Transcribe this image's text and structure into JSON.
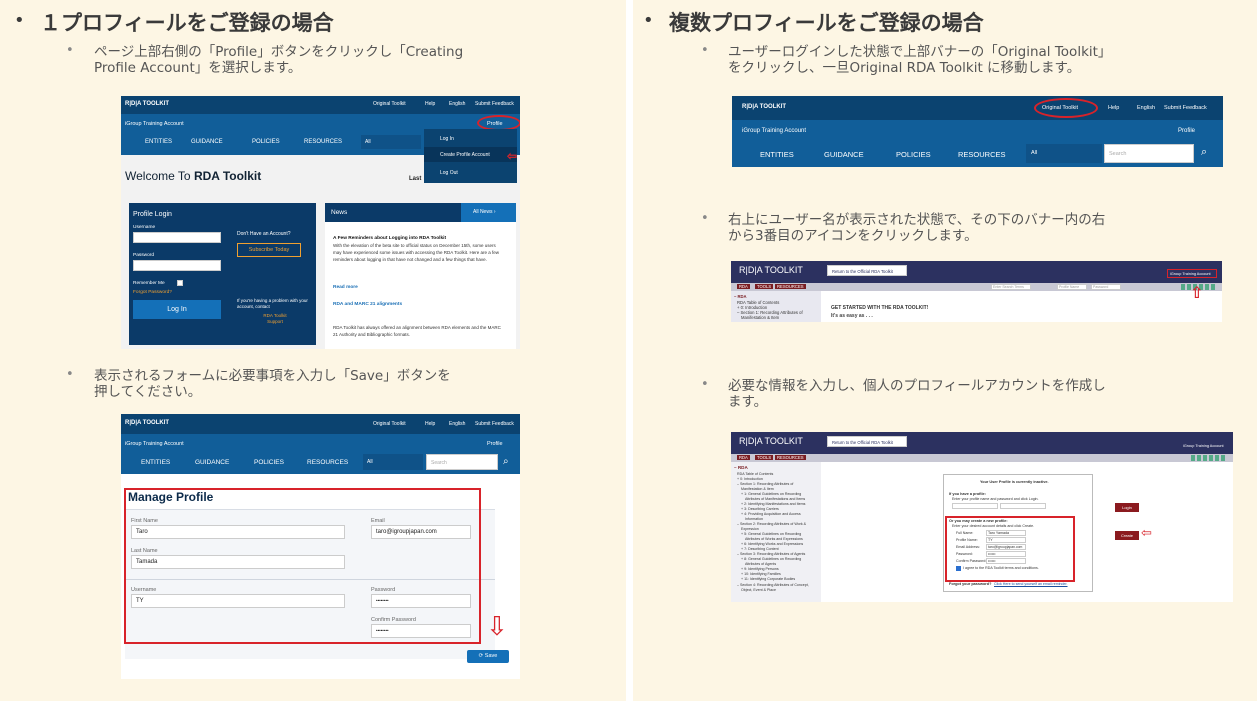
{
  "left": {
    "heading": "１プロフィールをご登録の場合",
    "step1": [
      "ページ上部右側の「Profile」ボタンをクリックし「Creating",
      "Profile Account」を選択します。"
    ],
    "step2": [
      "表示されるフォームに必要事項を入力し「Save」ボタンを",
      "押してください。"
    ],
    "shot1": {
      "logo": "R|D|A TOOLKIT",
      "top_links": [
        "Original Toolkit",
        "Help",
        "English",
        "Submit Feedback"
      ],
      "account": "iGroup Training Account",
      "profile": "Profile",
      "nav": [
        "ENTITIES",
        "GUIDANCE",
        "POLICIES",
        "RESOURCES",
        "All"
      ],
      "menu": [
        "Log In",
        "Create Profile Account",
        "Log Out"
      ],
      "welcome": "Welcome To",
      "welcome_bold": "RDA Toolkit",
      "last": "Last",
      "login": {
        "title": "Profile Login",
        "username": "Username",
        "password": "Password",
        "remember": "Remember Me",
        "forgot": "Forgot Password?",
        "button": "Log In",
        "no_account": "Don't Have an Account?",
        "subscribe": "Subscribe Today",
        "problem": "If you're having a problem with your account, contact",
        "support": "RDA Toolkit Support"
      },
      "news": {
        "title": "News",
        "all": "All News ›",
        "h1": "A Few Reminders about Logging into RDA Toolkit",
        "p1": "With the elevation of the beta site to official status on December 15th, some users may have experienced some issues with accessing the RDA Toolkit. Here are a few reminders about logging in that have not changed and a few things that have.",
        "more": "Read more",
        "h2": "RDA and MARC 21 alignments",
        "p2": "RDA Toolkit has always offered an alignment between RDA elements and the MARC 21 Authority and Bibliographic formats."
      }
    },
    "shot2": {
      "logo": "R|D|A TOOLKIT",
      "top_links": [
        "Original Toolkit",
        "Help",
        "English",
        "Submit Feedback"
      ],
      "account": "iGroup Training Account",
      "profile": "Profile",
      "nav": [
        "ENTITIES",
        "GUIDANCE",
        "POLICIES",
        "RESOURCES",
        "All"
      ],
      "search": "Search",
      "title": "Manage Profile",
      "first_name_label": "First Name",
      "first_name": "Taro",
      "email_label": "Email",
      "email": "taro@igroupjapan.com",
      "last_name_label": "Last Name",
      "last_name": "Tamada",
      "username_label": "Username",
      "username": "TY",
      "password_label": "Password",
      "password": "••••••••",
      "confirm_label": "Confirm Password",
      "confirm": "••••••••",
      "save": "Save"
    }
  },
  "right": {
    "heading": "複数プロフィールをご登録の場合",
    "step1": [
      "ユーザーログインした状態で上部バナーの「Original Toolkit」",
      "をクリックし、一旦Original RDA Toolkit に移動します。"
    ],
    "step2": [
      "右上にユーザー名が表示された状態で、その下のバナー内の右",
      "から3番目のアイコンをクリックします。"
    ],
    "step3": [
      "必要な情報を入力し、個人のプロフィールアカウントを作成し",
      "ます。"
    ],
    "shot1": {
      "logo": "R|D|A TOOLKIT",
      "top_links": [
        "Original Toolkit",
        "Help",
        "English",
        "Submit Feedback"
      ],
      "account": "iGroup Training Account",
      "profile": "Profile",
      "nav": [
        "ENTITIES",
        "GUIDANCE",
        "POLICIES",
        "RESOURCES",
        "All"
      ],
      "search": "Search"
    },
    "shot2": {
      "logo": "R|D|A TOOLKIT",
      "return": "Return to the Official RDA Toolkit",
      "account": "iGroup Training Account",
      "tabs": [
        "RDA",
        "TOOLS",
        "RESOURCES"
      ],
      "search_ph": "Enter Search Terms",
      "profile_ph": "Profile Name",
      "pw_ph": "Password",
      "get_started": "GET STARTED WITH THE RDA TOOLKIT!",
      "easy": "It's as easy as . . .",
      "toc": [
        "– RDA",
        "RDA Table of Contents",
        "+ 0: Introduction",
        "– Section 1: Recording Attributes of",
        "Manifestation & Item"
      ]
    },
    "shot3": {
      "logo": "R|D|A TOOLKIT",
      "return": "Return to the Official RDA Toolkit",
      "account": "iGroup Training Account",
      "tabs": [
        "RDA",
        "TOOLS",
        "RESOURCES"
      ],
      "inactive": "Your User Profile is currently inactive.",
      "have": "If you have a profile:",
      "have_hint": "Enter your profile name and password and click Login.",
      "login": "Login",
      "create_title": "Or you may create a new profile:",
      "create_hint": "Enter your desired account details and click Create.",
      "fields": [
        [
          "Full Name:",
          "Taro Yamada"
        ],
        [
          "Profile Name:",
          "TY"
        ],
        [
          "Email Address:",
          "taro@igroupjapan.com"
        ],
        [
          "Password:",
          "••••••"
        ],
        [
          "Confirm Password:",
          "••••••"
        ]
      ],
      "agree": "I agree to the RDA Toolkit terms and conditions.",
      "create": "Create",
      "forgot": "Forgot your password?",
      "forgot_link": "Click Here to send yourself an email reminder.",
      "toc": [
        "– RDA",
        "RDA Table of Contents",
        "+ 0: Introduction",
        "– Section 1: Recording Attributes of",
        "Manifestation & Item",
        "+ 1: General Guidelines on Recording",
        "Attributes of Manifestations and Items",
        "+ 2: Identifying Manifestations and Items",
        "+ 3: Describing Carriers",
        "+ 4: Providing Acquisition and Access",
        "Information",
        "– Section 2: Recording Attributes of Work &",
        "Expression",
        "+ 5: General Guidelines on Recording",
        "Attributes of Works and Expressions",
        "+ 6: Identifying Works and Expressions",
        "+ 7: Describing Content",
        "– Section 3: Recording Attributes of Agents",
        "+ 8: General Guidelines on Recording",
        "Attributes of Agents",
        "+ 9: Identifying Persons",
        "+ 10: Identifying Families",
        "+ 11: Identifying Corporate Bodies",
        "– Section 4: Recording Attributes of Concept,",
        "Object, Event & Place"
      ]
    }
  }
}
